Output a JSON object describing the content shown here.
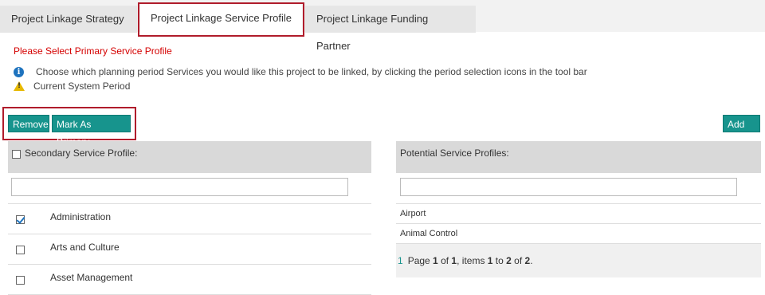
{
  "tabs": [
    {
      "label": "Project Linkage Strategy"
    },
    {
      "label": "Project Linkage Service Profile"
    },
    {
      "label": "Project Linkage Funding Partner"
    }
  ],
  "messages": {
    "error": "Please Select Primary Service Profile",
    "info": "Choose which planning period Services you would like this project to be linked, by clicking the period selection icons in the tool bar",
    "warning": "Current System Period"
  },
  "toolbar": {
    "remove_label": "Remove",
    "mark_primary_label": "Mark As Primary",
    "add_all_label": "Add All"
  },
  "secondary": {
    "header": "Secondary Service Profile:",
    "filter_value": "",
    "items": [
      {
        "label": "Administration",
        "checked": true
      },
      {
        "label": "Arts and Culture",
        "checked": false
      },
      {
        "label": "Asset Management",
        "checked": false
      }
    ]
  },
  "potential": {
    "header": "Potential Service Profiles:",
    "filter_value": "",
    "items": [
      {
        "label": "Airport"
      },
      {
        "label": "Animal Control"
      }
    ],
    "pager": {
      "current_page": "1",
      "text_page": "Page ",
      "page": "1",
      "text_of": " of ",
      "total_pages": "1",
      "text_items": ", items ",
      "from": "1",
      "text_to": " to ",
      "to": "2",
      "text_of2": " of ",
      "total": "2",
      "text_end": "."
    }
  },
  "colors": {
    "accent": "#17948d",
    "error": "#d40000",
    "highlight_border": "#b01c2b",
    "info_icon": "#1e73be",
    "warning_icon": "#e6b800"
  },
  "icons": [
    "info-icon",
    "warning-icon",
    "checkbox-icon"
  ]
}
